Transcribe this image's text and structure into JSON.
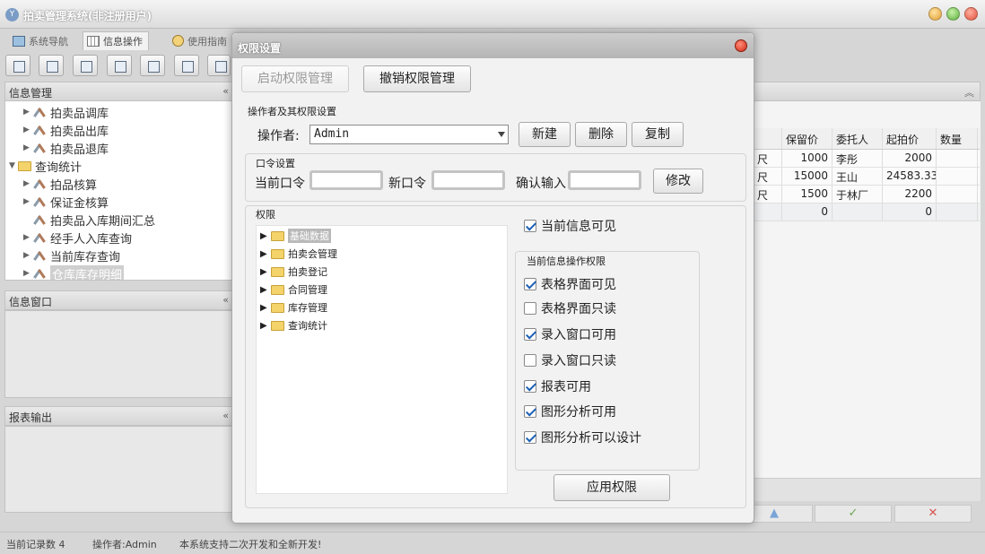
{
  "window": {
    "title": "拍卖管理系统(非注册用户)",
    "app_icon": "app-logo-icon"
  },
  "tabs": [
    {
      "label": "系统导航"
    },
    {
      "label": "信息操作"
    },
    {
      "label": "使用指南"
    }
  ],
  "left": {
    "info_mgmt": {
      "title": "信息管理"
    },
    "tree": [
      {
        "label": "拍卖品调库"
      },
      {
        "label": "拍卖品出库"
      },
      {
        "label": "拍卖品退库"
      },
      {
        "label": "查询统计"
      },
      {
        "label": "拍品核算"
      },
      {
        "label": "保证金核算"
      },
      {
        "label": "拍卖品入库期间汇总"
      },
      {
        "label": "经手人入库查询"
      },
      {
        "label": "当前库存查询"
      },
      {
        "label": "仓库库存明细"
      }
    ],
    "info_window": {
      "title": "信息窗口"
    },
    "report_output": {
      "title": "报表输出"
    }
  },
  "table": {
    "headers": [
      "保留价",
      "委托人",
      "起拍价",
      "数量"
    ],
    "rows": [
      {
        "unit": "尺",
        "reserve": "1000",
        "client": "李彤",
        "start": "2000"
      },
      {
        "unit": "尺",
        "reserve": "15000",
        "client": "王山",
        "start": "24583.33"
      },
      {
        "unit": "尺",
        "reserve": "1500",
        "client": "于林厂",
        "start": "2200"
      },
      {
        "unit": "",
        "reserve": "0",
        "client": "",
        "start": "0"
      }
    ]
  },
  "footer_icons": [
    "up-arrow-icon",
    "check-icon",
    "x-icon"
  ],
  "status": {
    "count": "当前记录数 4",
    "operator": "操作者:Admin",
    "msg": "本系统支持二次开发和全新开发!"
  },
  "dialog": {
    "title": "权限设置",
    "enable_label": "启动权限管理",
    "revoke_label": "撤销权限管理",
    "operator_group": "操作者及其权限设置",
    "operator_label": "操作者:",
    "operator_value": "Admin",
    "new_label": "新建",
    "delete_label": "删除",
    "copy_label": "复制",
    "password_group": "口令设置",
    "current_pwd": "当前口令",
    "new_pwd": "新口令",
    "confirm_pwd": "确认输入",
    "modify_label": "修改",
    "perm_group": "权限",
    "perm_tree": [
      {
        "label": "基础数据"
      },
      {
        "label": "拍卖会管理"
      },
      {
        "label": "拍卖登记"
      },
      {
        "label": "合同管理"
      },
      {
        "label": "库存管理"
      },
      {
        "label": "查询统计"
      }
    ],
    "visible_label": "当前信息可见",
    "ops_group": "当前信息操作权限",
    "ops": [
      {
        "label": "表格界面可见",
        "checked": true
      },
      {
        "label": "表格界面只读",
        "checked": false
      },
      {
        "label": "录入窗口可用",
        "checked": true
      },
      {
        "label": "录入窗口只读",
        "checked": false
      },
      {
        "label": "报表可用",
        "checked": true
      },
      {
        "label": "图形分析可用",
        "checked": true
      },
      {
        "label": "图形分析可以设计",
        "checked": true
      }
    ],
    "apply_label": "应用权限"
  }
}
